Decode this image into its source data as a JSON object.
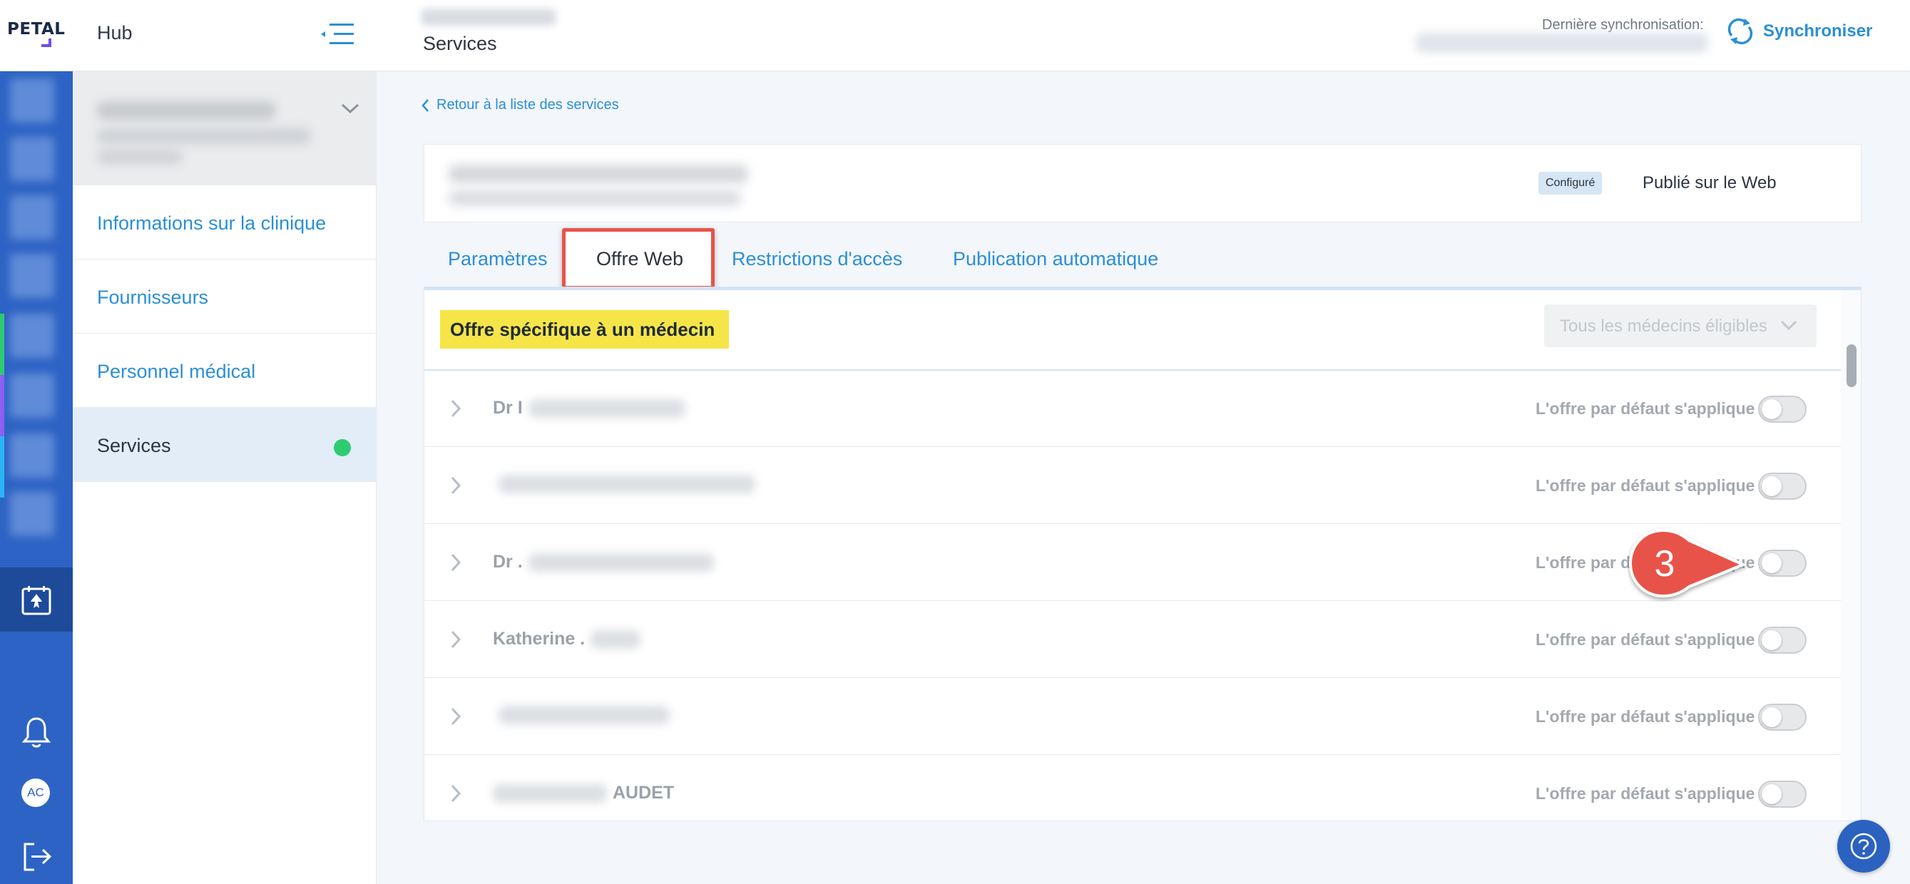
{
  "app": {
    "logo": "PETAL",
    "title": "Hub"
  },
  "header": {
    "page_title": "Services",
    "sync_label": "Dernière synchronisation:",
    "sync_button": "Synchroniser"
  },
  "rail": {
    "avatar_initials": "AC"
  },
  "sidebar": {
    "items": [
      {
        "label": "Informations sur la clinique"
      },
      {
        "label": "Fournisseurs"
      },
      {
        "label": "Personnel médical"
      },
      {
        "label": "Services"
      }
    ]
  },
  "main": {
    "back_link": "Retour à la liste des services",
    "status_badge": "Configuré",
    "published_label": "Publié sur le Web",
    "tabs": [
      {
        "label": "Paramètres"
      },
      {
        "label": "Offre Web"
      },
      {
        "label": "Restrictions d'accès"
      },
      {
        "label": "Publication automatique"
      }
    ],
    "offer_title": "Offre spécifique à un médecin",
    "doctor_filter": "Tous les médecins éligibles",
    "rows": [
      {
        "name": "Dr I",
        "default_label": "L'offre par défaut s'applique"
      },
      {
        "name": "",
        "default_label": "L'offre par défaut s'applique"
      },
      {
        "name": "Dr .",
        "default_label": "L'offre par défaut s'applique"
      },
      {
        "name": "Katherine .",
        "default_label": "L'offre par défaut s'applique"
      },
      {
        "name": "",
        "default_label": "L'offre par défaut s'applique"
      },
      {
        "name": "AUDET",
        "default_label": "L'offre par défaut s'applique"
      }
    ],
    "callout_number": "3"
  },
  "colors": {
    "accent": "#2b8fd6",
    "rail": "#2d63c4",
    "highlight_yellow": "#f6e548",
    "callout_red": "#e8534a",
    "status_green": "#2ecc71"
  },
  "help_button": {
    "icon": "question-icon"
  }
}
